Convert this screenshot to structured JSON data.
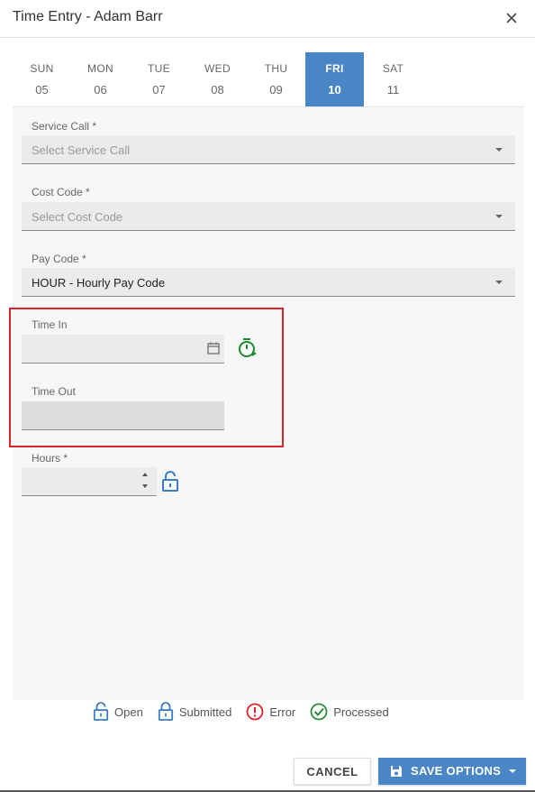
{
  "dialog": {
    "title": "Time Entry - Adam Barr",
    "close_icon": "close-icon"
  },
  "days": [
    {
      "dow": "SUN",
      "num": "05",
      "active": false
    },
    {
      "dow": "MON",
      "num": "06",
      "active": false
    },
    {
      "dow": "TUE",
      "num": "07",
      "active": false
    },
    {
      "dow": "WED",
      "num": "08",
      "active": false
    },
    {
      "dow": "THU",
      "num": "09",
      "active": false
    },
    {
      "dow": "FRI",
      "num": "10",
      "active": true
    },
    {
      "dow": "SAT",
      "num": "11",
      "active": false
    }
  ],
  "form": {
    "service_call": {
      "label": "Service Call *",
      "placeholder": "Select Service Call",
      "value": ""
    },
    "cost_code": {
      "label": "Cost Code *",
      "placeholder": "Select Cost Code",
      "value": ""
    },
    "pay_code": {
      "label": "Pay Code *",
      "value": "HOUR - Hourly Pay Code"
    },
    "time_in": {
      "label": "Time In",
      "value": ""
    },
    "time_out": {
      "label": "Time Out",
      "value": ""
    },
    "hours": {
      "label": "Hours *",
      "value": ""
    }
  },
  "legend": [
    {
      "label": "Open",
      "icon": "unlock-icon"
    },
    {
      "label": "Submitted",
      "icon": "lock-icon"
    },
    {
      "label": "Error",
      "icon": "error-icon"
    },
    {
      "label": "Processed",
      "icon": "check-circle-icon"
    }
  ],
  "buttons": {
    "cancel": "CANCEL",
    "save": "SAVE OPTIONS"
  },
  "colors": {
    "accent": "#4a86c5",
    "highlight_border": "#d9232a",
    "timer_green": "#1e8c2e",
    "error_red": "#d9232a",
    "processed_green": "#2e8b3a"
  }
}
